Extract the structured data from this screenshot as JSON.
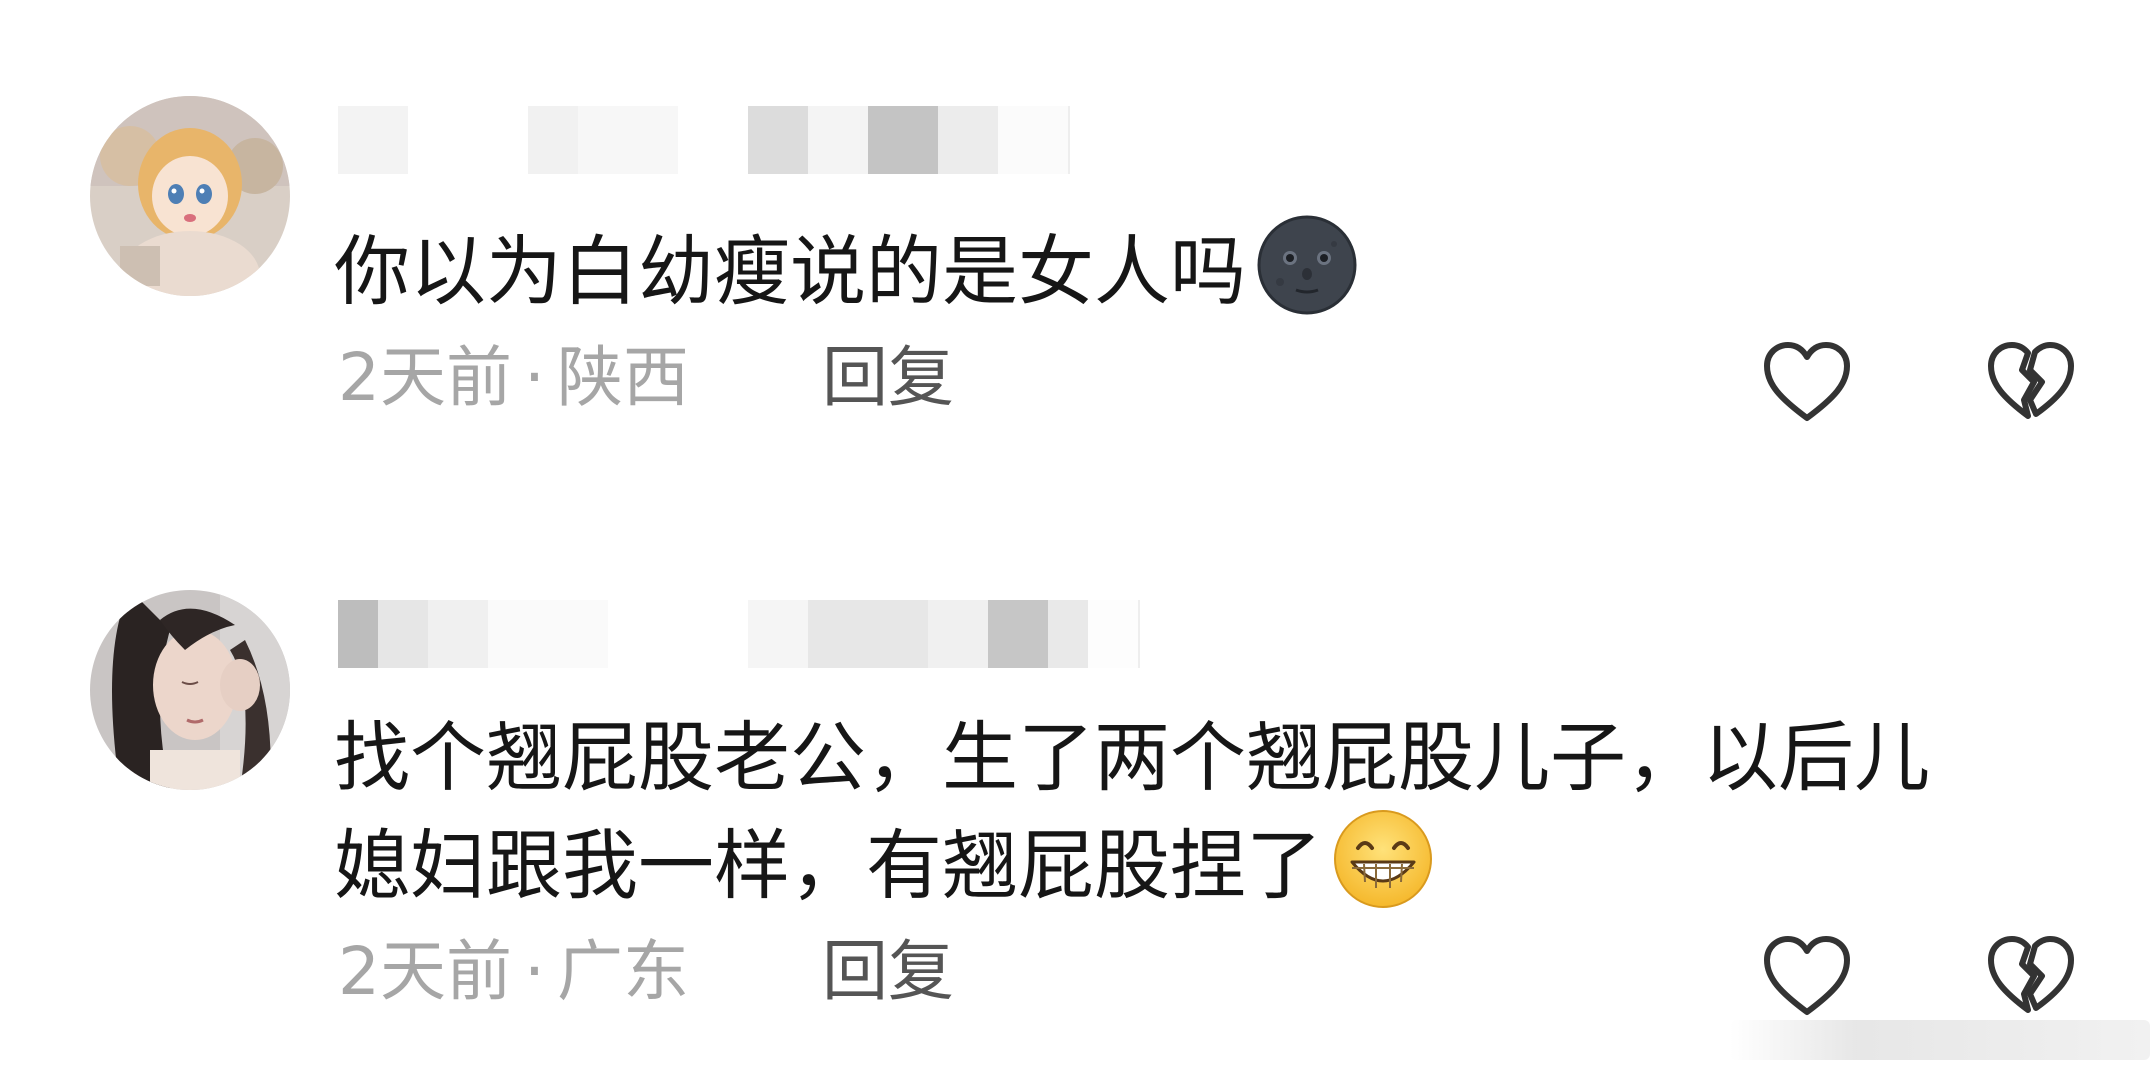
{
  "comments": [
    {
      "text": "你以为白幼瘦说的是女人吗",
      "emoji_icon": "new-moon-face-emoji",
      "time": "2天前",
      "separator": "·",
      "location": "陕西",
      "reply_label": "回复",
      "like_icon": "heart-outline-icon",
      "dislike_icon": "broken-heart-outline-icon"
    },
    {
      "text_line1": "找个翘屁股老公，生了两个翘屁股儿子，以后儿",
      "text_line2": "媳妇跟我一样，有翘屁股捏了",
      "emoji_icon": "grinning-face-emoji",
      "time": "2天前",
      "separator": "·",
      "location": "广东",
      "reply_label": "回复",
      "like_icon": "heart-outline-icon",
      "dislike_icon": "broken-heart-outline-icon"
    }
  ],
  "colors": {
    "text": "#161616",
    "meta": "#a6a6a6",
    "reply": "#555555",
    "icon_stroke": "#333333"
  }
}
